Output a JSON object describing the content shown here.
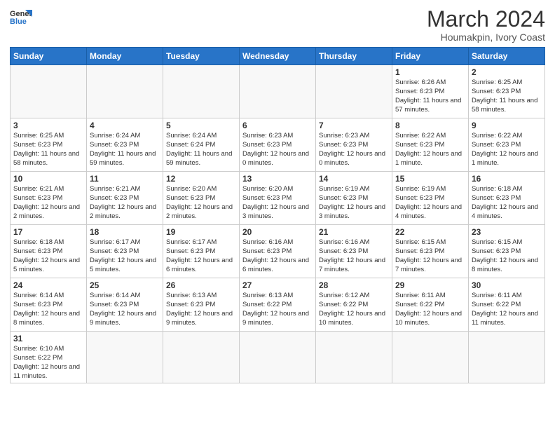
{
  "logo": {
    "line1": "General",
    "line2": "Blue"
  },
  "title": "March 2024",
  "subtitle": "Houmakpin, Ivory Coast",
  "days_header": [
    "Sunday",
    "Monday",
    "Tuesday",
    "Wednesday",
    "Thursday",
    "Friday",
    "Saturday"
  ],
  "weeks": [
    [
      {
        "day": "",
        "info": ""
      },
      {
        "day": "",
        "info": ""
      },
      {
        "day": "",
        "info": ""
      },
      {
        "day": "",
        "info": ""
      },
      {
        "day": "",
        "info": ""
      },
      {
        "day": "1",
        "info": "Sunrise: 6:26 AM\nSunset: 6:23 PM\nDaylight: 11 hours\nand 57 minutes."
      },
      {
        "day": "2",
        "info": "Sunrise: 6:25 AM\nSunset: 6:23 PM\nDaylight: 11 hours\nand 58 minutes."
      }
    ],
    [
      {
        "day": "3",
        "info": "Sunrise: 6:25 AM\nSunset: 6:23 PM\nDaylight: 11 hours\nand 58 minutes."
      },
      {
        "day": "4",
        "info": "Sunrise: 6:24 AM\nSunset: 6:23 PM\nDaylight: 11 hours\nand 59 minutes."
      },
      {
        "day": "5",
        "info": "Sunrise: 6:24 AM\nSunset: 6:24 PM\nDaylight: 11 hours\nand 59 minutes."
      },
      {
        "day": "6",
        "info": "Sunrise: 6:23 AM\nSunset: 6:23 PM\nDaylight: 12 hours\nand 0 minutes."
      },
      {
        "day": "7",
        "info": "Sunrise: 6:23 AM\nSunset: 6:23 PM\nDaylight: 12 hours\nand 0 minutes."
      },
      {
        "day": "8",
        "info": "Sunrise: 6:22 AM\nSunset: 6:23 PM\nDaylight: 12 hours\nand 1 minute."
      },
      {
        "day": "9",
        "info": "Sunrise: 6:22 AM\nSunset: 6:23 PM\nDaylight: 12 hours\nand 1 minute."
      }
    ],
    [
      {
        "day": "10",
        "info": "Sunrise: 6:21 AM\nSunset: 6:23 PM\nDaylight: 12 hours\nand 2 minutes."
      },
      {
        "day": "11",
        "info": "Sunrise: 6:21 AM\nSunset: 6:23 PM\nDaylight: 12 hours\nand 2 minutes."
      },
      {
        "day": "12",
        "info": "Sunrise: 6:20 AM\nSunset: 6:23 PM\nDaylight: 12 hours\nand 2 minutes."
      },
      {
        "day": "13",
        "info": "Sunrise: 6:20 AM\nSunset: 6:23 PM\nDaylight: 12 hours\nand 3 minutes."
      },
      {
        "day": "14",
        "info": "Sunrise: 6:19 AM\nSunset: 6:23 PM\nDaylight: 12 hours\nand 3 minutes."
      },
      {
        "day": "15",
        "info": "Sunrise: 6:19 AM\nSunset: 6:23 PM\nDaylight: 12 hours\nand 4 minutes."
      },
      {
        "day": "16",
        "info": "Sunrise: 6:18 AM\nSunset: 6:23 PM\nDaylight: 12 hours\nand 4 minutes."
      }
    ],
    [
      {
        "day": "17",
        "info": "Sunrise: 6:18 AM\nSunset: 6:23 PM\nDaylight: 12 hours\nand 5 minutes."
      },
      {
        "day": "18",
        "info": "Sunrise: 6:17 AM\nSunset: 6:23 PM\nDaylight: 12 hours\nand 5 minutes."
      },
      {
        "day": "19",
        "info": "Sunrise: 6:17 AM\nSunset: 6:23 PM\nDaylight: 12 hours\nand 6 minutes."
      },
      {
        "day": "20",
        "info": "Sunrise: 6:16 AM\nSunset: 6:23 PM\nDaylight: 12 hours\nand 6 minutes."
      },
      {
        "day": "21",
        "info": "Sunrise: 6:16 AM\nSunset: 6:23 PM\nDaylight: 12 hours\nand 7 minutes."
      },
      {
        "day": "22",
        "info": "Sunrise: 6:15 AM\nSunset: 6:23 PM\nDaylight: 12 hours\nand 7 minutes."
      },
      {
        "day": "23",
        "info": "Sunrise: 6:15 AM\nSunset: 6:23 PM\nDaylight: 12 hours\nand 8 minutes."
      }
    ],
    [
      {
        "day": "24",
        "info": "Sunrise: 6:14 AM\nSunset: 6:23 PM\nDaylight: 12 hours\nand 8 minutes."
      },
      {
        "day": "25",
        "info": "Sunrise: 6:14 AM\nSunset: 6:23 PM\nDaylight: 12 hours\nand 9 minutes."
      },
      {
        "day": "26",
        "info": "Sunrise: 6:13 AM\nSunset: 6:23 PM\nDaylight: 12 hours\nand 9 minutes."
      },
      {
        "day": "27",
        "info": "Sunrise: 6:13 AM\nSunset: 6:22 PM\nDaylight: 12 hours\nand 9 minutes."
      },
      {
        "day": "28",
        "info": "Sunrise: 6:12 AM\nSunset: 6:22 PM\nDaylight: 12 hours\nand 10 minutes."
      },
      {
        "day": "29",
        "info": "Sunrise: 6:11 AM\nSunset: 6:22 PM\nDaylight: 12 hours\nand 10 minutes."
      },
      {
        "day": "30",
        "info": "Sunrise: 6:11 AM\nSunset: 6:22 PM\nDaylight: 12 hours\nand 11 minutes."
      }
    ],
    [
      {
        "day": "31",
        "info": "Sunrise: 6:10 AM\nSunset: 6:22 PM\nDaylight: 12 hours\nand 11 minutes."
      },
      {
        "day": "",
        "info": ""
      },
      {
        "day": "",
        "info": ""
      },
      {
        "day": "",
        "info": ""
      },
      {
        "day": "",
        "info": ""
      },
      {
        "day": "",
        "info": ""
      },
      {
        "day": "",
        "info": ""
      }
    ]
  ]
}
